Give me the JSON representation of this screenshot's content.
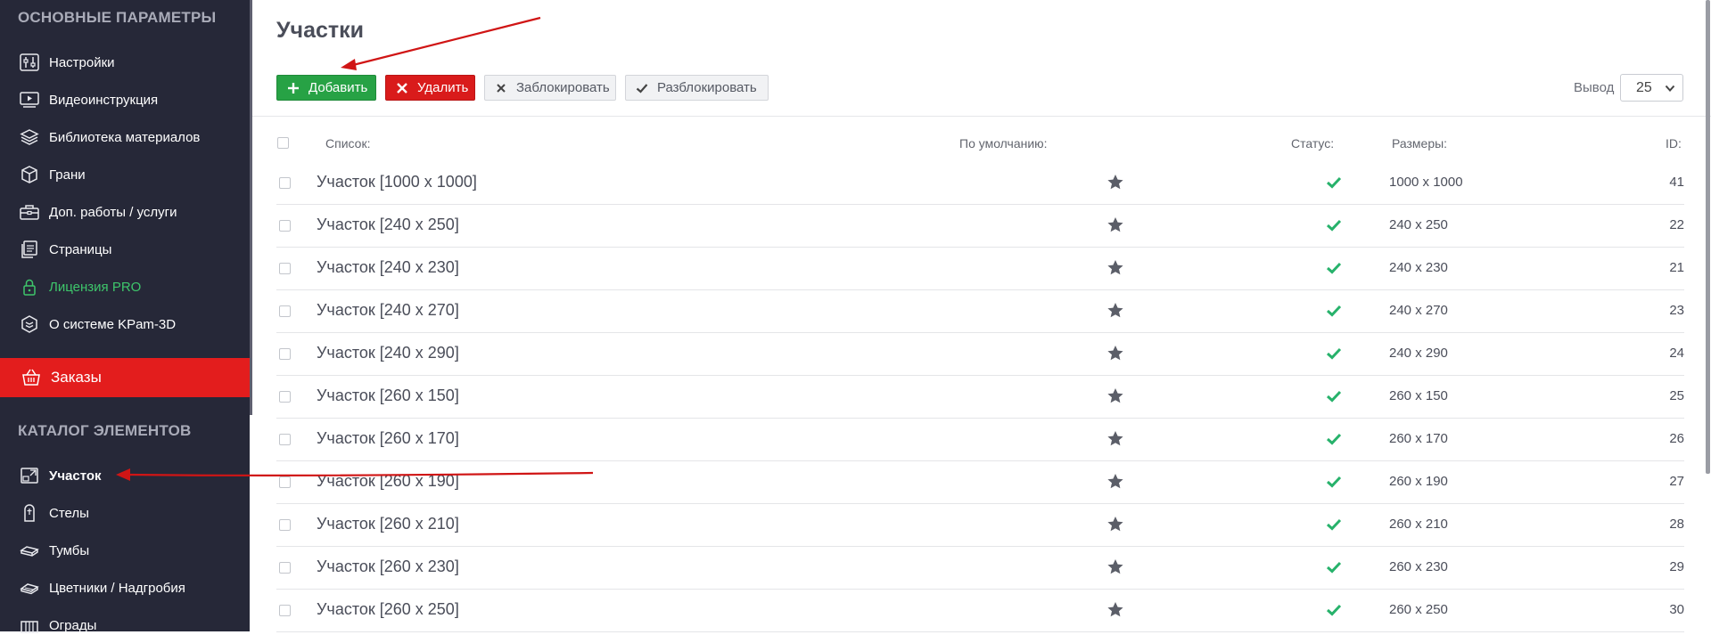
{
  "sidebar": {
    "section_main": "ОСНОВНЫЕ ПАРАМЕТРЫ",
    "items_main": [
      {
        "label": "Настройки",
        "icon": "sliders-icon"
      },
      {
        "label": "Видеоинструкция",
        "icon": "video-icon"
      },
      {
        "label": "Библиотека материалов",
        "icon": "layers-icon"
      },
      {
        "label": "Грани",
        "icon": "cube-icon"
      },
      {
        "label": "Доп. работы / услуги",
        "icon": "toolbox-icon"
      },
      {
        "label": "Страницы",
        "icon": "pages-icon"
      },
      {
        "label": "Лицензия PRO",
        "icon": "lock-icon"
      },
      {
        "label": "О системе KPam-3D",
        "icon": "layers-badge-icon"
      }
    ],
    "orders": {
      "label": "Заказы",
      "icon": "basket-icon"
    },
    "section_catalog": "КАТАЛОГ ЭЛЕМЕНТОВ",
    "items_catalog": [
      {
        "label": "Участок",
        "icon": "plot-icon",
        "active": true
      },
      {
        "label": "Стелы",
        "icon": "stele-icon"
      },
      {
        "label": "Тумбы",
        "icon": "pedestal-icon"
      },
      {
        "label": "Цветники / Надгробия",
        "icon": "flowerbed-icon"
      },
      {
        "label": "Ограды",
        "icon": "fence-icon"
      }
    ]
  },
  "page": {
    "title": "Участки"
  },
  "toolbar": {
    "add": "Добавить",
    "delete": "Удалить",
    "block": "Заблокировать",
    "unblock": "Разблокировать",
    "output_label": "Вывод",
    "output_value": "25"
  },
  "table": {
    "headers": {
      "list": "Список:",
      "default": "По умолчанию:",
      "status": "Статус:",
      "sizes": "Размеры:",
      "id": "ID:"
    },
    "rows": [
      {
        "name": "Участок [1000 x 1000]",
        "size": "1000 x 1000",
        "id": "41"
      },
      {
        "name": "Участок [240 x 250]",
        "size": "240 x 250",
        "id": "22"
      },
      {
        "name": "Участок [240 x 230]",
        "size": "240 x 230",
        "id": "21"
      },
      {
        "name": "Участок [240 x 270]",
        "size": "240 x 270",
        "id": "23"
      },
      {
        "name": "Участок [240 x 290]",
        "size": "240 x 290",
        "id": "24"
      },
      {
        "name": "Участок [260 x 150]",
        "size": "260 x 150",
        "id": "25"
      },
      {
        "name": "Участок [260 x 170]",
        "size": "260 x 170",
        "id": "26"
      },
      {
        "name": "Участок [260 x 190]",
        "size": "260 x 190",
        "id": "27"
      },
      {
        "name": "Участок [260 x 210]",
        "size": "260 x 210",
        "id": "28"
      },
      {
        "name": "Участок [260 x 230]",
        "size": "260 x 230",
        "id": "29"
      },
      {
        "name": "Участок [260 x 250]",
        "size": "260 x 250",
        "id": "30"
      }
    ]
  },
  "colors": {
    "sidebar_bg": "#262838",
    "orders_bg": "#e31d1d",
    "add_btn": "#27a245",
    "delete_btn": "#d91b1b",
    "license_text": "#3ec66b",
    "status_check": "#27b26b",
    "annotation_arrow": "#d01515"
  }
}
